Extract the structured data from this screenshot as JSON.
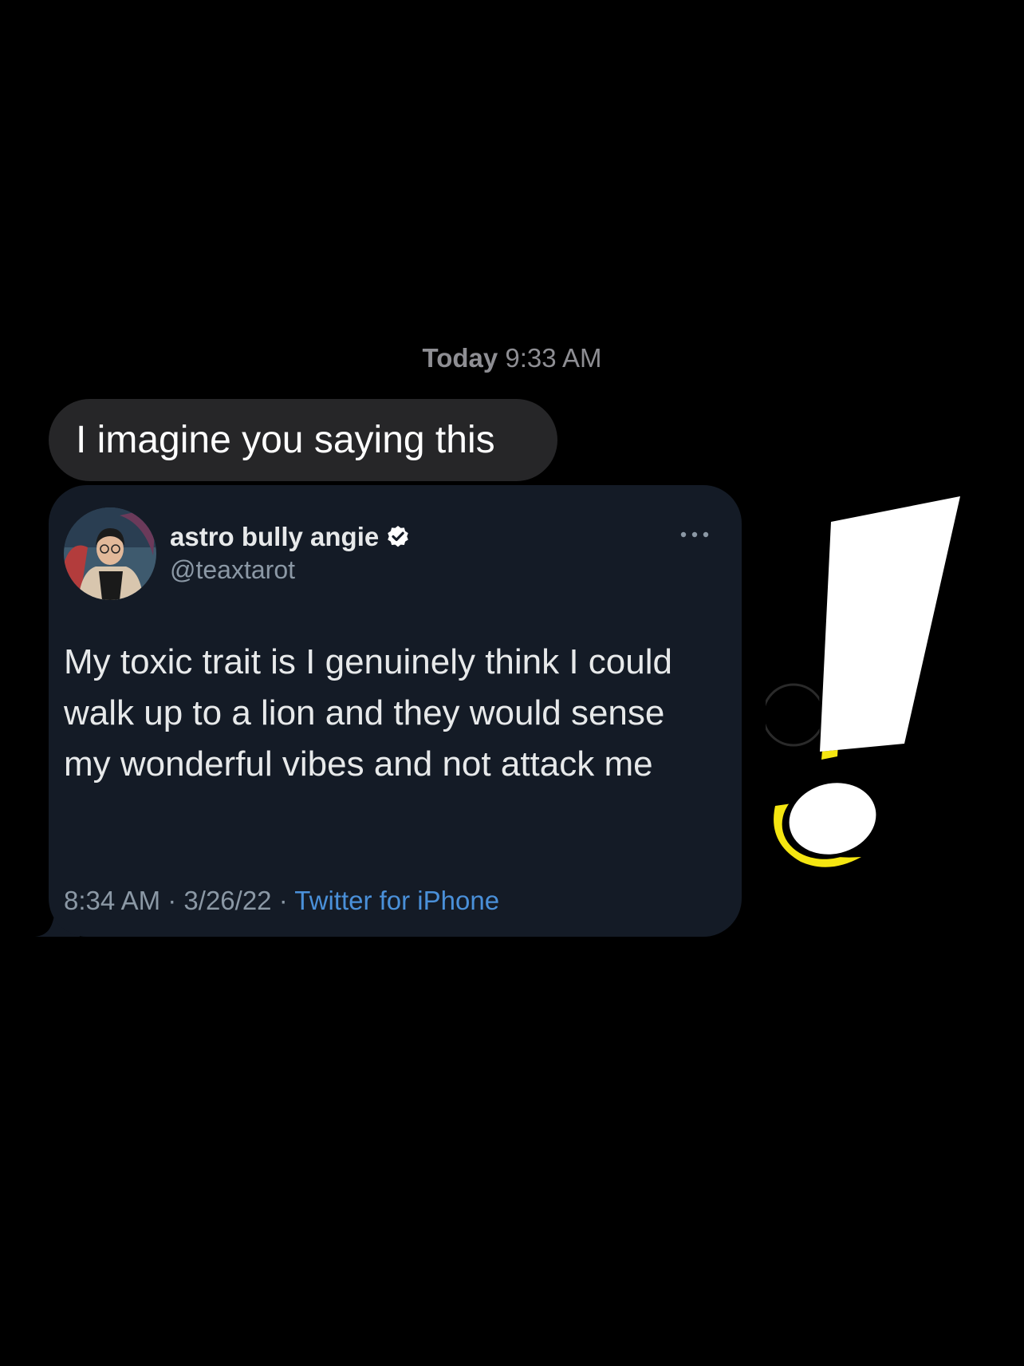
{
  "conversation": {
    "timestamp_day": "Today",
    "timestamp_time": "9:33 AM"
  },
  "message": {
    "text": "I imagine you saying this"
  },
  "tweet": {
    "author_name": "astro bully angie",
    "author_handle": "@teaxtarot",
    "text": "My toxic trait is I genuinely think I could walk up to a lion and they would sense my wonderful vibes and not attack me",
    "time": "8:34 AM",
    "date": "3/26/22",
    "separator": "·",
    "source": "Twitter for iPhone",
    "verified": true
  },
  "icons": {
    "verified": "verified-badge-icon",
    "more": "more-horizontal-icon",
    "sticker": "exclamation-mark-sticker"
  },
  "colors": {
    "background": "#000000",
    "message_bubble": "#262628",
    "tweet_card": "#141b26",
    "tweet_source_link": "#4a90d9",
    "timestamp": "#8e8e93",
    "sticker_accent": "#f5e611"
  }
}
